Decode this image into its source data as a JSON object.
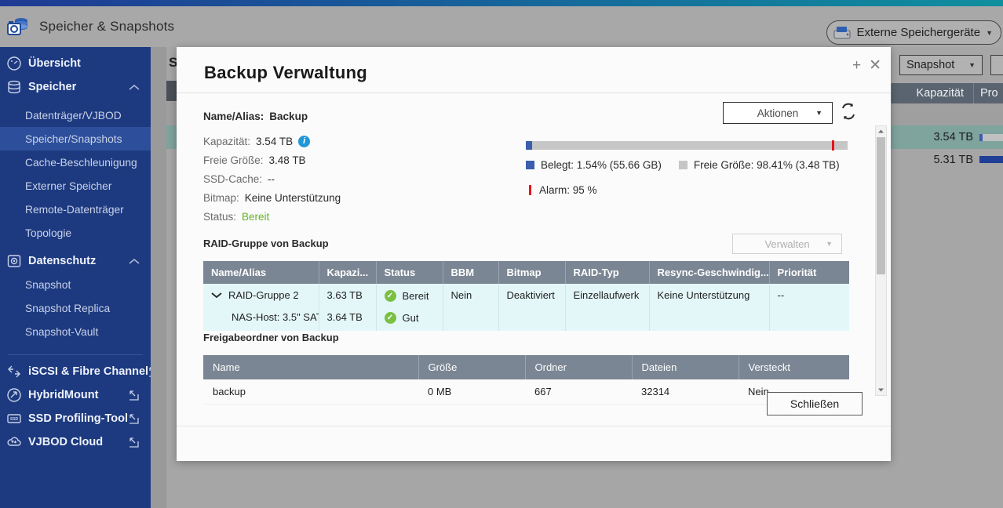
{
  "app": {
    "title": "Speicher & Snapshots",
    "app_icon": "storage-snapshots-icon",
    "external_storage_button": "Externe Speichergeräte"
  },
  "sidebar": {
    "items": [
      {
        "label": "Übersicht",
        "icon": "gauge-icon",
        "level": "top",
        "active": false,
        "chevron": false,
        "external": false
      },
      {
        "label": "Speicher",
        "icon": "database-icon",
        "level": "top",
        "active": false,
        "chevron": true,
        "external": false
      },
      {
        "label": "Datenträger/VJBOD",
        "icon": "",
        "level": "sub",
        "active": false,
        "chevron": false,
        "external": false
      },
      {
        "label": "Speicher/Snapshots",
        "icon": "",
        "level": "sub",
        "active": true,
        "chevron": false,
        "external": false
      },
      {
        "label": "Cache-Beschleunigung",
        "icon": "",
        "level": "sub",
        "active": false,
        "chevron": false,
        "external": false
      },
      {
        "label": "Externer Speicher",
        "icon": "",
        "level": "sub",
        "active": false,
        "chevron": false,
        "external": false
      },
      {
        "label": "Remote-Datenträger",
        "icon": "",
        "level": "sub",
        "active": false,
        "chevron": false,
        "external": false
      },
      {
        "label": "Topologie",
        "icon": "",
        "level": "sub",
        "active": false,
        "chevron": false,
        "external": false
      },
      {
        "label": "Datenschutz",
        "icon": "shield-icon",
        "level": "top",
        "active": false,
        "chevron": true,
        "external": false
      },
      {
        "label": "Snapshot",
        "icon": "",
        "level": "sub",
        "active": false,
        "chevron": false,
        "external": false
      },
      {
        "label": "Snapshot Replica",
        "icon": "",
        "level": "sub",
        "active": false,
        "chevron": false,
        "external": false
      },
      {
        "label": "Snapshot-Vault",
        "icon": "",
        "level": "sub",
        "active": false,
        "chevron": false,
        "external": false
      },
      {
        "label": "iSCSI & Fibre Channel",
        "icon": "iscsi-icon",
        "level": "top",
        "active": false,
        "chevron": false,
        "external": true
      },
      {
        "label": "HybridMount",
        "icon": "mount-icon",
        "level": "top",
        "active": false,
        "chevron": false,
        "external": true
      },
      {
        "label": "SSD Profiling-Tool",
        "icon": "ssd-icon",
        "level": "top",
        "active": false,
        "chevron": false,
        "external": true
      },
      {
        "label": "VJBOD Cloud",
        "icon": "cloud-icon",
        "level": "top",
        "active": false,
        "chevron": false,
        "external": true
      }
    ]
  },
  "background": {
    "page_initial": "S",
    "snapshot_button": "Snapshot",
    "columns": [
      "Kapazität",
      "Pro"
    ],
    "rows": [
      {
        "capacity": "3.54 TB",
        "used_pct": 4
      },
      {
        "capacity": "5.31 TB",
        "used_pct": 100
      }
    ]
  },
  "dialog": {
    "title": "Backup  Verwaltung",
    "add_icon": "plus-icon",
    "close_icon": "close-icon",
    "refresh_icon": "refresh-icon",
    "actions_button": "Aktionen",
    "manage_button": "Verwalten",
    "close_button": "Schließen",
    "info": [
      {
        "label": "Name/Alias:",
        "value": "Backup",
        "bold": true,
        "state": ""
      },
      {
        "label": "Kapazität:",
        "value": "3.54 TB",
        "bold": false,
        "state": "info"
      },
      {
        "label": "Freie Größe:",
        "value": "3.48 TB",
        "bold": false,
        "state": ""
      },
      {
        "label": "SSD-Cache:",
        "value": "--",
        "bold": false,
        "state": ""
      },
      {
        "label": "Bitmap:",
        "value": "Keine Unterstützung",
        "bold": false,
        "state": ""
      },
      {
        "label": "Status:",
        "value": "Bereit",
        "bold": false,
        "state": "ok"
      }
    ],
    "usage": {
      "used_pct": 1.54,
      "alarm_pct": 95,
      "used_color": "#3b5fad",
      "free_color": "#c6c6c6",
      "alarm_color": "#e5131b",
      "legend_used": "Belegt: 1.54% (55.66 GB)",
      "legend_free": "Freie Größe: 98.41% (3.48 TB)",
      "legend_alarm": "Alarm: 95 %"
    },
    "raid_section_label": "RAID-Gruppe von Backup",
    "raid_table": {
      "columns": [
        "Name/Alias",
        "Kapazi...",
        "Status",
        "BBM",
        "Bitmap",
        "RAID-Typ",
        "Resync-Geschwindig...",
        "Priorität"
      ],
      "rows": [
        {
          "name": "RAID-Gruppe 2",
          "expanded": true,
          "indent": false,
          "capacity": "3.63 TB",
          "status": "Bereit",
          "bbm": "Nein",
          "bitmap": "Deaktiviert",
          "raid_type": "Einzellaufwerk",
          "resync": "Keine Unterstützung",
          "priority": "--"
        },
        {
          "name": "NAS-Host: 3.5\" SAT...",
          "expanded": false,
          "indent": true,
          "capacity": "3.64 TB",
          "status": "Gut",
          "bbm": "",
          "bitmap": "",
          "raid_type": "",
          "resync": "",
          "priority": ""
        }
      ]
    },
    "share_section_label": "Freigabeordner von Backup",
    "share_table": {
      "columns": [
        "Name",
        "Größe",
        "Ordner",
        "Dateien",
        "Versteckt"
      ],
      "rows": [
        {
          "name": "backup",
          "size": "0 MB",
          "folders": "667",
          "files": "32314",
          "hidden": "Nein"
        }
      ]
    }
  }
}
